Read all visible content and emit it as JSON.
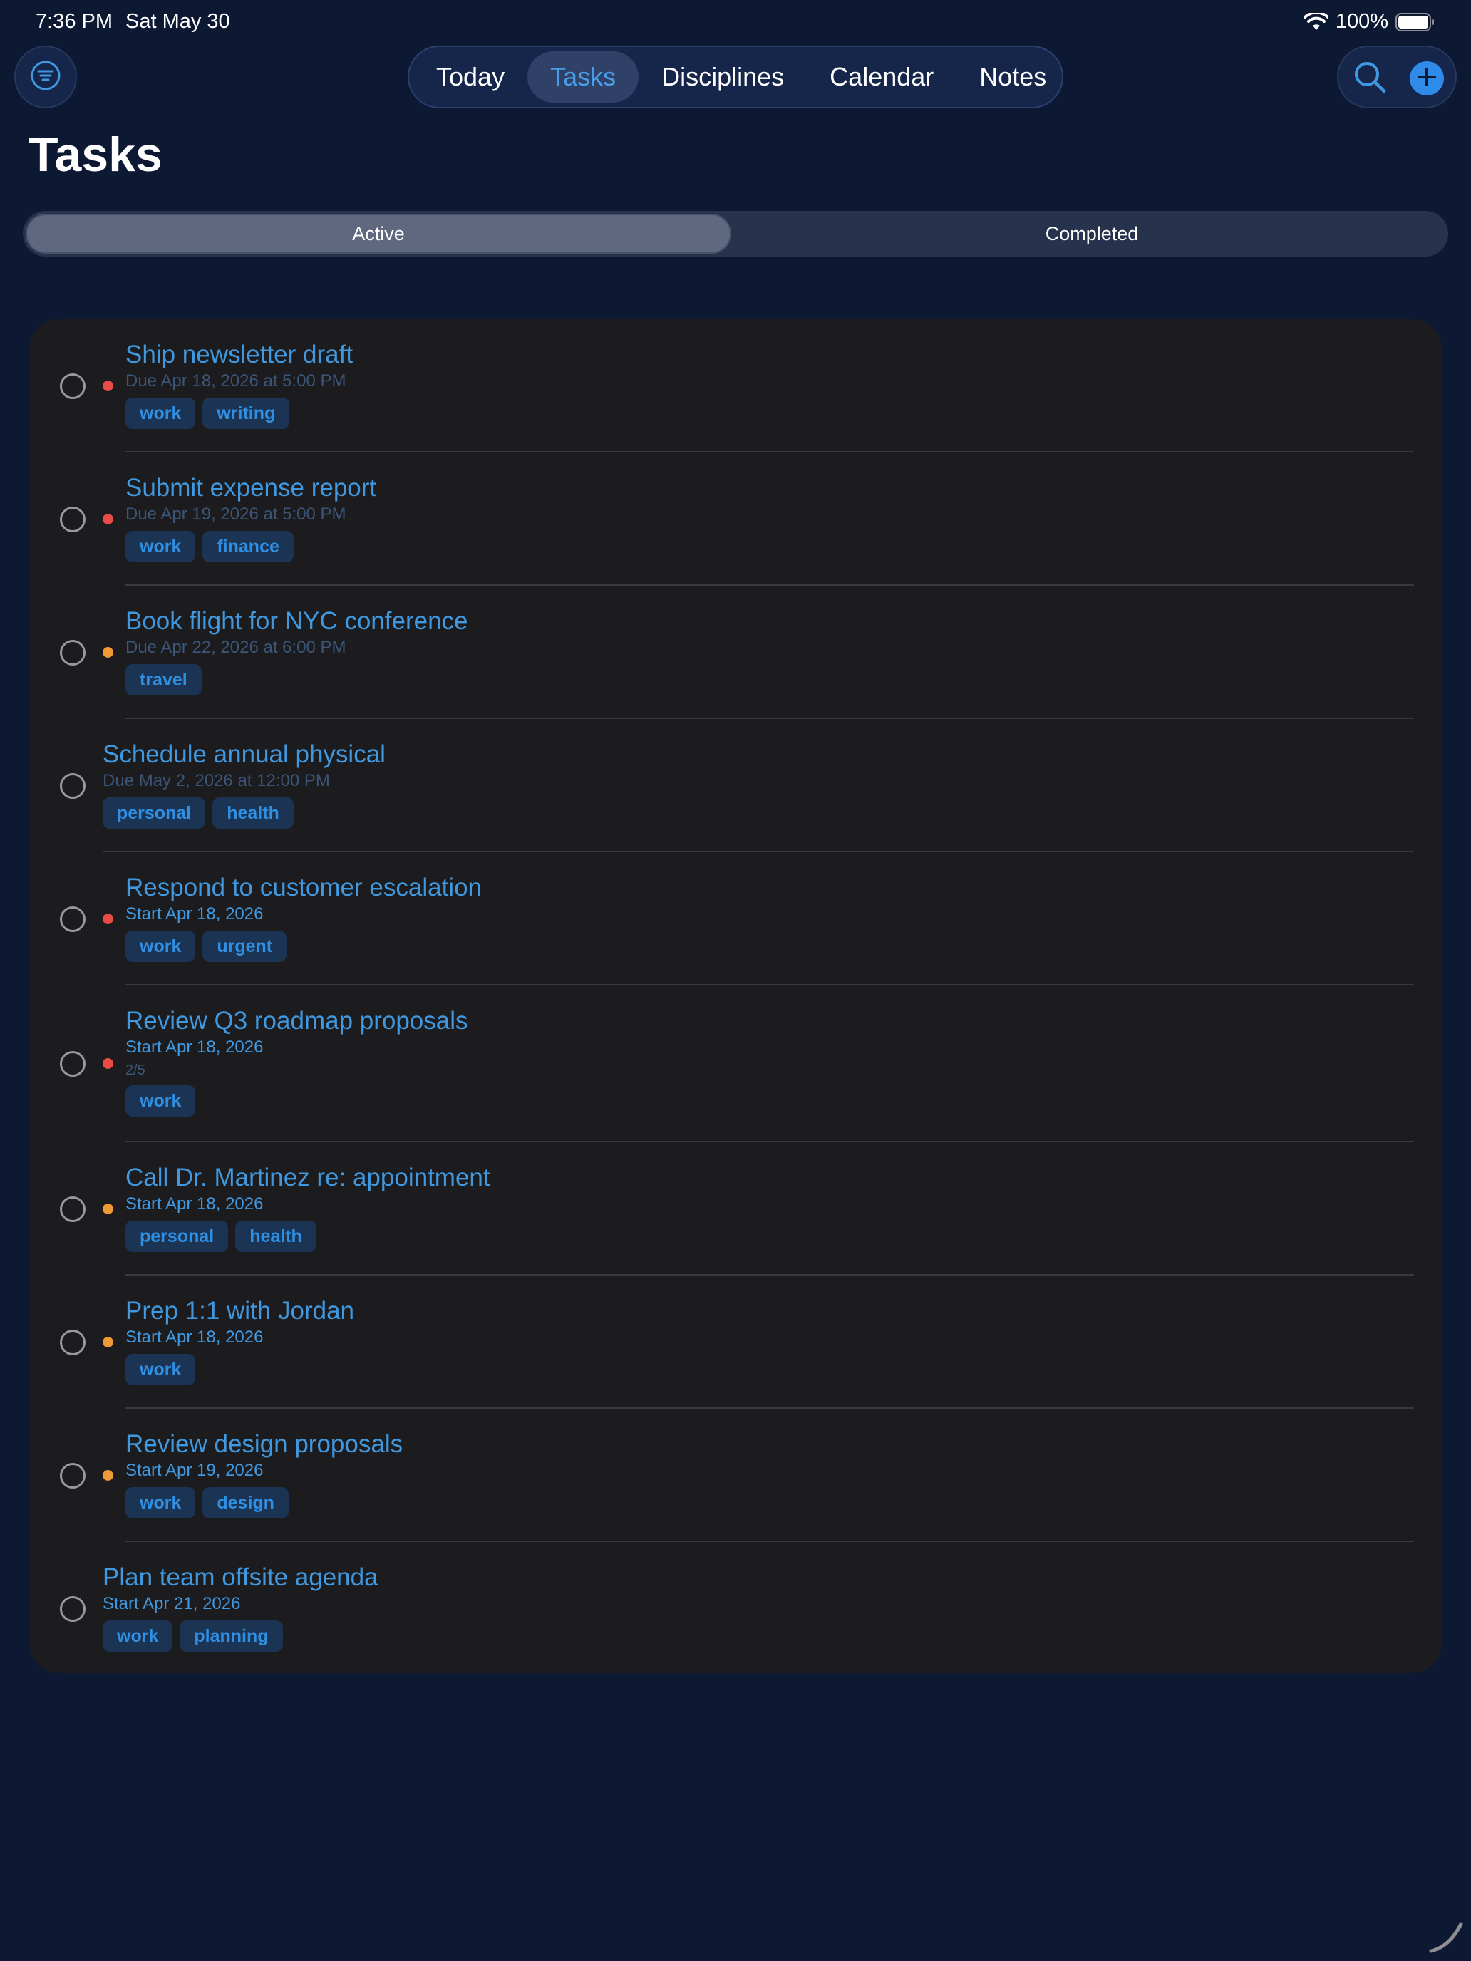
{
  "status_bar": {
    "time": "7:36 PM",
    "date": "Sat May 30",
    "battery": "100%",
    "wifi_icon": "wifi-icon",
    "battery_icon": "battery-icon"
  },
  "nav": {
    "tabs": [
      {
        "label": "Today",
        "active": false
      },
      {
        "label": "Tasks",
        "active": true
      },
      {
        "label": "Disciplines",
        "active": false
      },
      {
        "label": "Calendar",
        "active": false
      },
      {
        "label": "Notes",
        "active": false
      }
    ],
    "filter_icon": "filter-icon",
    "search_icon": "search-icon",
    "add_icon": "plus-icon"
  },
  "page": {
    "title": "Tasks"
  },
  "segments": {
    "options": [
      "Active",
      "Completed"
    ],
    "selected": "Active"
  },
  "colors": {
    "accent": "#3f98e0",
    "priority_high": "#ea4b47",
    "priority_medium": "#f09a37",
    "background": "#0d1833",
    "card": "#1c1c1e"
  },
  "tasks": [
    {
      "title": "Ship newsletter draft",
      "date_label": "Due Apr 18, 2026 at 5:00 PM",
      "date_kind": "due",
      "priority": "high",
      "tags": [
        "work",
        "writing"
      ]
    },
    {
      "title": "Submit expense report",
      "date_label": "Due Apr 19, 2026 at 5:00 PM",
      "date_kind": "due",
      "priority": "high",
      "tags": [
        "work",
        "finance"
      ]
    },
    {
      "title": "Book flight for NYC conference",
      "date_label": "Due Apr 22, 2026 at 6:00 PM",
      "date_kind": "due",
      "priority": "medium",
      "tags": [
        "travel"
      ]
    },
    {
      "title": "Schedule annual physical",
      "date_label": "Due May 2, 2026 at 12:00 PM",
      "date_kind": "due",
      "priority": "none",
      "tags": [
        "personal",
        "health"
      ]
    },
    {
      "title": "Respond to customer escalation",
      "date_label": "Start Apr 18, 2026",
      "date_kind": "start",
      "priority": "high",
      "tags": [
        "work",
        "urgent"
      ]
    },
    {
      "title": "Review Q3 roadmap proposals",
      "date_label": "Start Apr 18, 2026",
      "date_kind": "start",
      "priority": "high",
      "progress": "2/5",
      "tags": [
        "work"
      ]
    },
    {
      "title": "Call Dr. Martinez re: appointment",
      "date_label": "Start Apr 18, 2026",
      "date_kind": "start",
      "priority": "medium",
      "tags": [
        "personal",
        "health"
      ]
    },
    {
      "title": "Prep 1:1 with Jordan",
      "date_label": "Start Apr 18, 2026",
      "date_kind": "start",
      "priority": "medium",
      "tags": [
        "work"
      ]
    },
    {
      "title": "Review design proposals",
      "date_label": "Start Apr 19, 2026",
      "date_kind": "start",
      "priority": "medium",
      "tags": [
        "work",
        "design"
      ]
    },
    {
      "title": "Plan team offsite agenda",
      "date_label": "Start Apr 21, 2026",
      "date_kind": "start",
      "priority": "none",
      "tags": [
        "work",
        "planning"
      ]
    }
  ]
}
